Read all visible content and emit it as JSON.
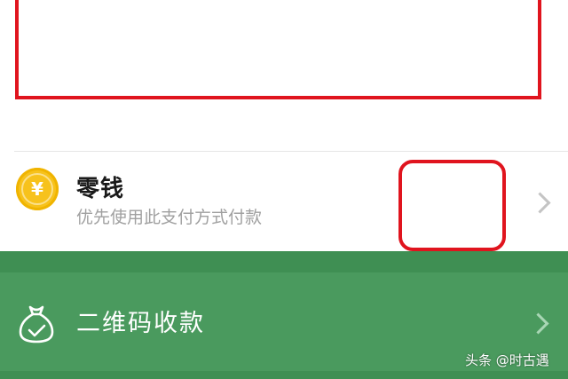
{
  "wallet": {
    "icon": "yuan-coin-icon",
    "coin_symbol": "¥",
    "title": "零钱",
    "subtitle": "优先使用此支付方式付款"
  },
  "qr_receive": {
    "icon": "money-bag-icon",
    "title": "二维码收款"
  },
  "watermark": "头条 @时古遇",
  "colors": {
    "annotation_red": "#e0141e",
    "green_bar": "#4a9a5e",
    "coin_yellow": "#f7c21c"
  }
}
